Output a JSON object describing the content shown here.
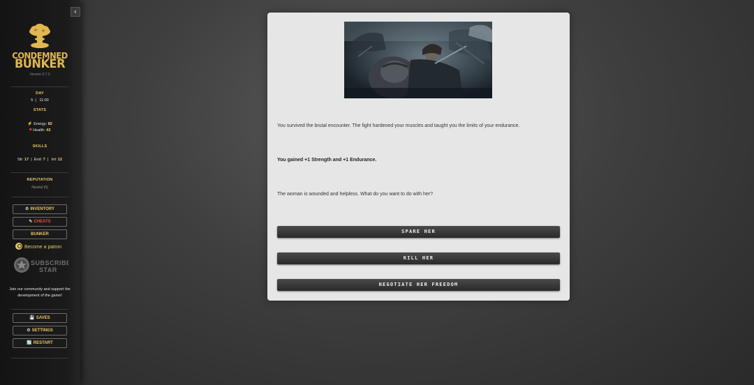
{
  "sidebar": {
    "collapse_icon": "chevron-left-icon",
    "logo": {
      "line1": "CONDEMNED",
      "line2": "BUNKER",
      "version": "Version 0.7.0",
      "icon": "mushroom-cloud-icon",
      "color": "#e2b650"
    },
    "day": {
      "title": "DAY",
      "day_number": "5",
      "time": "11:00"
    },
    "stats": {
      "title": "STATS",
      "energy_label": "Energy:",
      "energy_value": "82",
      "health_label": "Health:",
      "health_value": "43"
    },
    "skills": {
      "title": "SKILLS",
      "str_label": "Str:",
      "str_value": "17",
      "end_label": "End:",
      "end_value": "7",
      "int_label": "Int:",
      "int_value": "12"
    },
    "reputation": {
      "title": "REPUTATION",
      "value": "Neutral (0)"
    },
    "buttons": {
      "inventory": "INVENTORY",
      "cheats": "CHEATS",
      "bunker": "BUNKER"
    },
    "patron": "Become a patron",
    "subscribestar": {
      "line1": "SUBSCRIBE",
      "line2": "STAR"
    },
    "community_text": "Join our community and support the development of the game!",
    "bottom_buttons": {
      "saves": "SAVES",
      "settings": "SETTINGS",
      "restart": "RESTART"
    },
    "accent_color": "#e8c862",
    "cheats_color": "#e0504a"
  },
  "main": {
    "image_alt": "battle-scene",
    "paragraph1": "You survived the brutal encounter. The fight hardened your muscles and taught you the limits of your endurance.",
    "paragraph2": "You gained +1 Strength and +1 Endurance.",
    "paragraph3": "The woman is wounded and helpless. What do you want to do with her?",
    "choices": [
      "SPARE HER",
      "KILL HER",
      "NEGOTIATE HER FREEDOM"
    ]
  }
}
